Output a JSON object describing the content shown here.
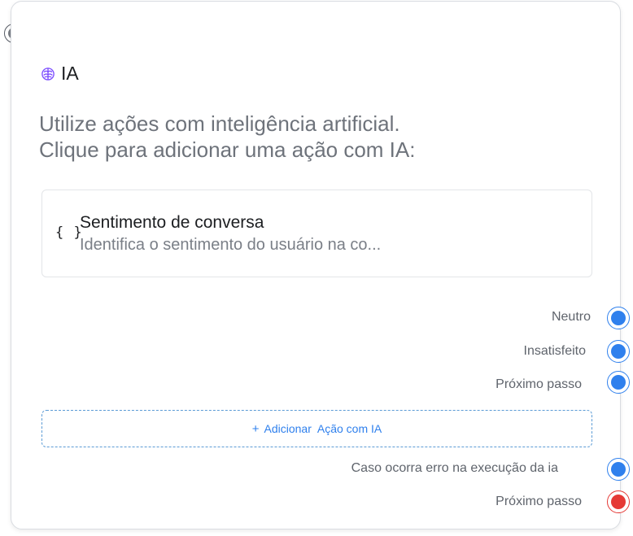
{
  "node": {
    "title": "IA",
    "title_icon": "brain-icon",
    "description_line1": "Utilize ações com inteligência artificial.",
    "description_line2": "Clique para adicionar uma ação com IA:"
  },
  "action": {
    "icon": "braces-icon",
    "icon_glyph": "{ }",
    "title": "Sentimento de conversa",
    "description": "Identifica o sentimento do usuário na co..."
  },
  "outputs": [
    {
      "label": "Neutro",
      "color": "#2f80ed"
    },
    {
      "label": "Insatisfeito",
      "color": "#2f80ed"
    },
    {
      "label": "Próximo passo",
      "color": "#2f80ed"
    }
  ],
  "add_button": {
    "plus": "+",
    "label": "Adicionar  Ação com IA"
  },
  "error_outputs": [
    {
      "label": "Caso ocorra erro na execução da ia",
      "color": "#2f80ed"
    },
    {
      "label": "Próximo passo",
      "color": "#e53935"
    }
  ],
  "colors": {
    "accent": "#2f80ed",
    "error": "#e53935",
    "brain_icon": "#7c4dff"
  }
}
